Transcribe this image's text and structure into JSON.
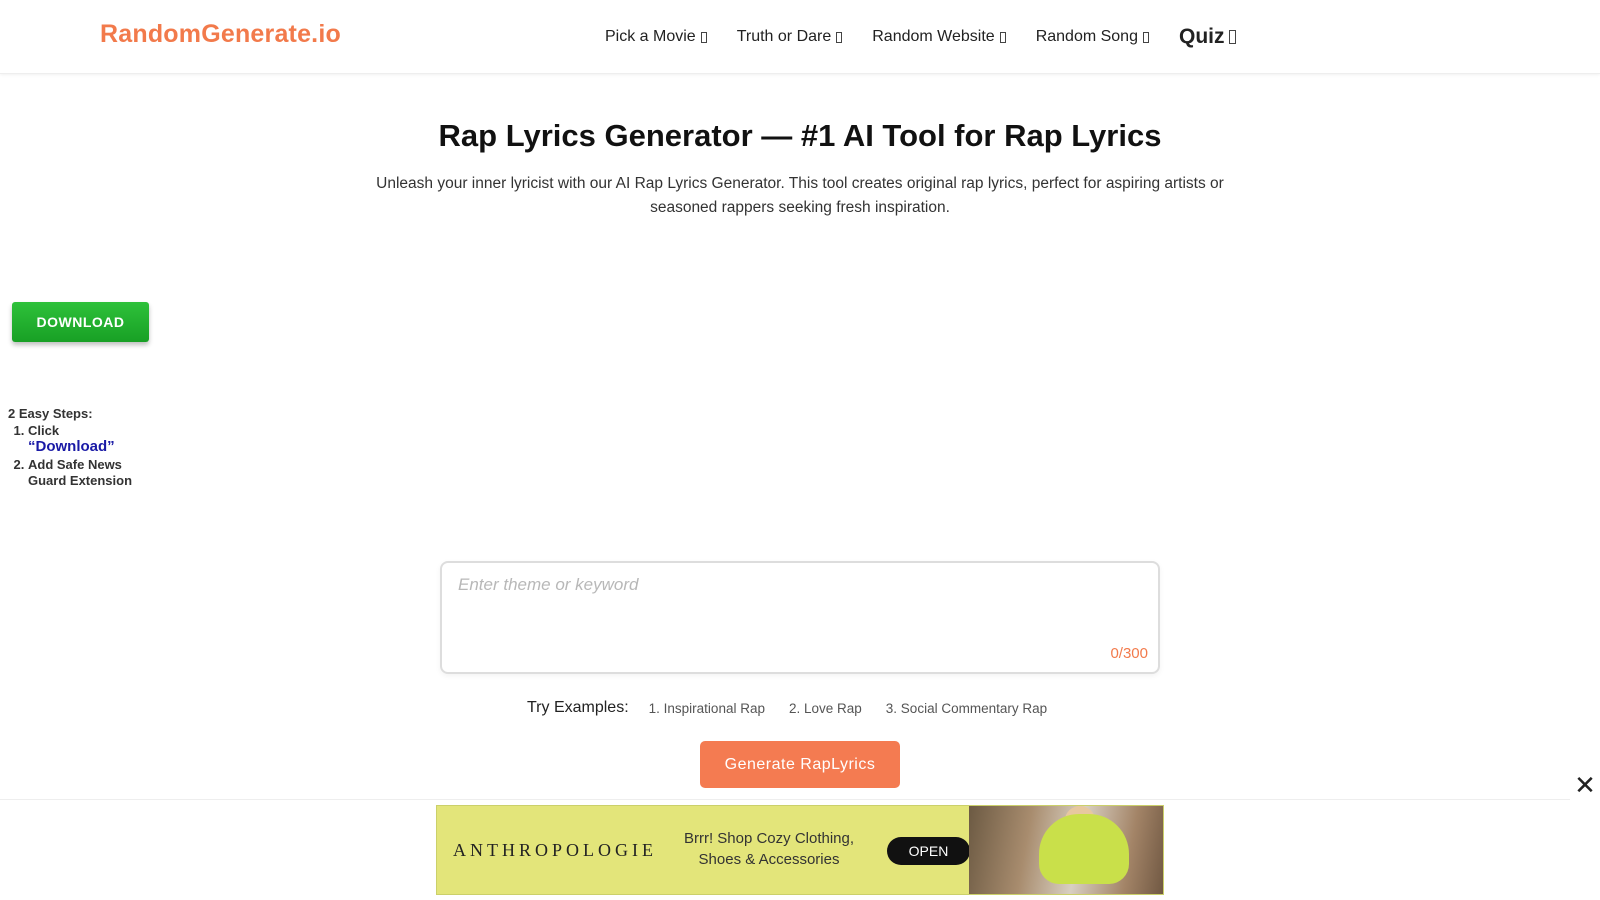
{
  "header": {
    "brand": "RandomGenerate.io",
    "nav": [
      {
        "label": "Pick a Movie"
      },
      {
        "label": "Truth or Dare"
      },
      {
        "label": "Random Website"
      },
      {
        "label": "Random Song"
      },
      {
        "label": "Quiz"
      }
    ]
  },
  "left_ad": {
    "download_label": "DOWNLOAD",
    "steps_title": "2 Easy Steps:",
    "step1_prefix": "Click",
    "step1_word": "“Download”",
    "step2": "Add Safe News Guard Extension"
  },
  "main": {
    "title": "Rap Lyrics Generator — #1 AI Tool for Rap Lyrics",
    "subtitle": "Unleash your inner lyricist with our AI Rap Lyrics Generator. This tool creates original rap lyrics, perfect for aspiring artists or seasoned rappers seeking fresh inspiration.",
    "input": {
      "placeholder": "Enter theme or keyword",
      "value": "",
      "counter": "0/300"
    },
    "examples_label": "Try Examples:",
    "examples": [
      "1. Inspirational Rap",
      "2. Love Rap",
      "3. Social Commentary Rap"
    ],
    "generate_label": "Generate RapLyrics"
  },
  "bottom_ad": {
    "brand": "ANTHROPOLOGIE",
    "message": "Brrr! Shop Cozy Clothing, Shoes & Accessories",
    "cta": "OPEN"
  },
  "colors": {
    "accent": "#f27a4b",
    "download_green": "#1fae2c",
    "banner_bg": "#e3e57a"
  }
}
